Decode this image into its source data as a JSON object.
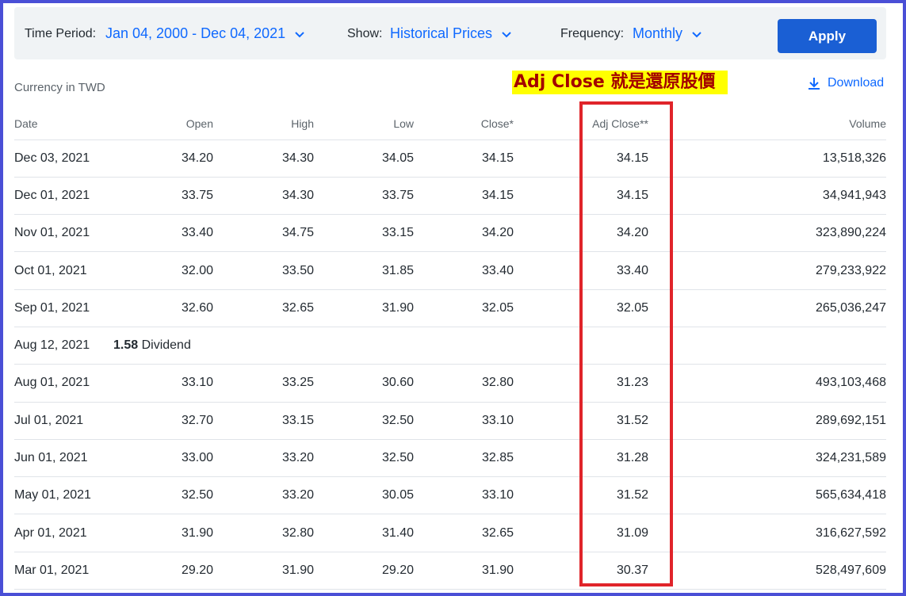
{
  "toolbar": {
    "time_period_label": "Time Period:",
    "time_period_value": "Jan 04, 2000 - Dec 04, 2021",
    "show_label": "Show:",
    "show_value": "Historical Prices",
    "frequency_label": "Frequency:",
    "frequency_value": "Monthly",
    "apply_label": "Apply"
  },
  "currency_note": "Currency in TWD",
  "annotation": "Adj Close 就是還原股價",
  "download_label": "Download",
  "colors": {
    "accent": "#0f69ff",
    "highlight_box": "#e0242a",
    "annotation_bg": "#ffff00",
    "annotation_text": "#a30000"
  },
  "table": {
    "headers": [
      "Date",
      "Open",
      "High",
      "Low",
      "Close*",
      "Adj Close**",
      "Volume"
    ],
    "rows": [
      [
        "Dec 03, 2021",
        "34.20",
        "34.30",
        "34.05",
        "34.15",
        "34.15",
        "13,518,326"
      ],
      [
        "Dec 01, 2021",
        "33.75",
        "34.30",
        "33.75",
        "34.15",
        "34.15",
        "34,941,943"
      ],
      [
        "Nov 01, 2021",
        "33.40",
        "34.75",
        "33.15",
        "34.20",
        "34.20",
        "323,890,224"
      ],
      [
        "Oct 01, 2021",
        "32.00",
        "33.50",
        "31.85",
        "33.40",
        "33.40",
        "279,233,922"
      ],
      [
        "Sep 01, 2021",
        "32.60",
        "32.65",
        "31.90",
        "32.05",
        "32.05",
        "265,036,247"
      ]
    ],
    "dividend": {
      "date": "Aug 12, 2021",
      "amount": "1.58",
      "label": " Dividend"
    },
    "rows2": [
      [
        "Aug 01, 2021",
        "33.10",
        "33.25",
        "30.60",
        "32.80",
        "31.23",
        "493,103,468"
      ],
      [
        "Jul 01, 2021",
        "32.70",
        "33.15",
        "32.50",
        "33.10",
        "31.52",
        "289,692,151"
      ],
      [
        "Jun 01, 2021",
        "33.00",
        "33.20",
        "32.50",
        "32.85",
        "31.28",
        "324,231,589"
      ],
      [
        "May 01, 2021",
        "32.50",
        "33.20",
        "30.05",
        "33.10",
        "31.52",
        "565,634,418"
      ],
      [
        "Apr 01, 2021",
        "31.90",
        "32.80",
        "31.40",
        "32.65",
        "31.09",
        "316,627,592"
      ],
      [
        "Mar 01, 2021",
        "29.20",
        "31.90",
        "29.20",
        "31.90",
        "30.37",
        "528,497,609"
      ]
    ]
  }
}
